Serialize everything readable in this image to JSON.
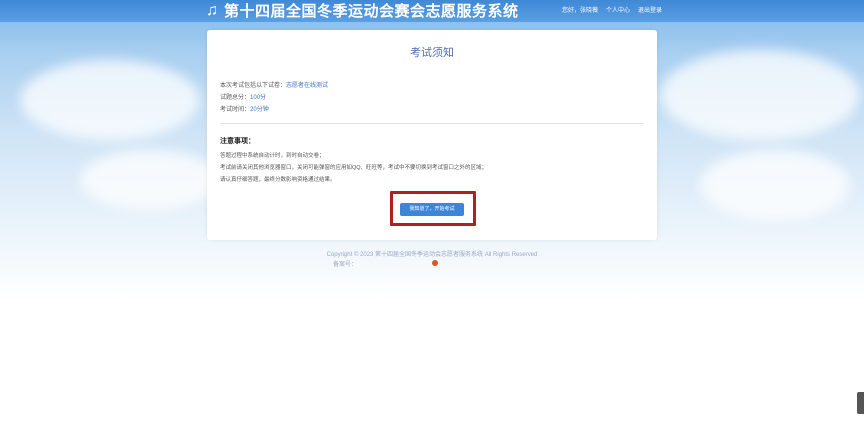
{
  "header": {
    "site_title": "第十四届全国冬季运动会赛会志愿服务系统",
    "nav": [
      "您好，张晓薇",
      "个人中心",
      "退出登录"
    ]
  },
  "card": {
    "title": "考试须知",
    "paper_label": "本次考试包括以下试卷：",
    "paper_value": "志愿者在线测试",
    "score_label": "试题总分：",
    "score_value": "100分",
    "time_label": "考试时间：",
    "time_value": "20分钟",
    "notice_title": "注意事项：",
    "notices": [
      "答题过程中系统自动计时，到时自动交卷；",
      "考试前请关闭其他浏览器窗口，关闭可能弹窗的应用如QQ、旺旺等，考试中不要切换到考试窗口之外的区域；",
      "请认真仔细答题，最终分数影响资格通过结果。"
    ],
    "start_button": "我知道了，开始考试"
  },
  "footer": {
    "copyright": "Copyright © 2023 第十四届全国冬季运动会志愿者服务系统 All Rights Reserved",
    "icp": "备案号："
  }
}
